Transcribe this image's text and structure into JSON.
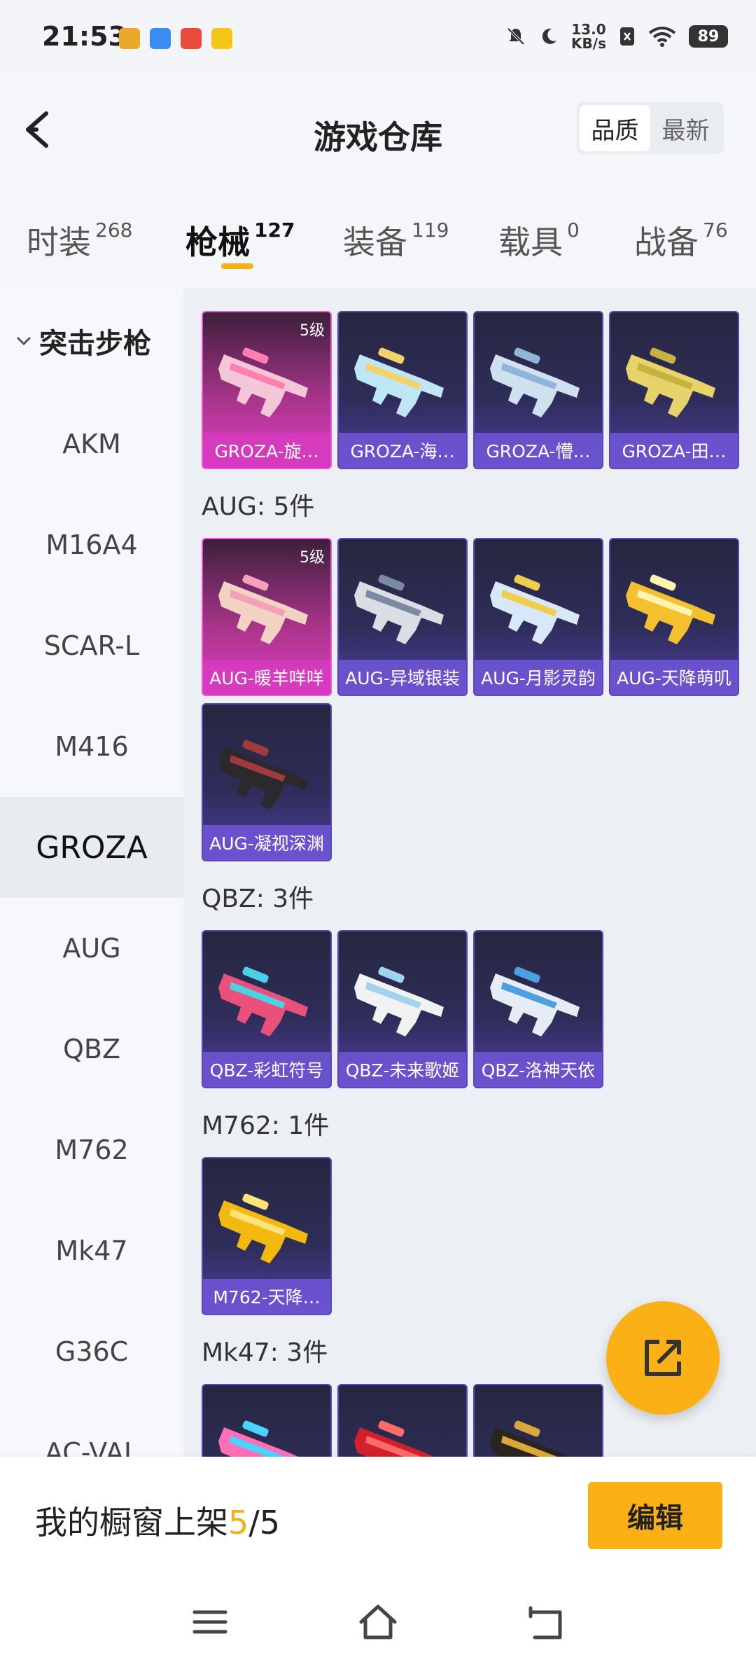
{
  "status_bar": {
    "time": "21:53",
    "net_speed_value": "13.0",
    "net_speed_unit": "KB/s",
    "battery": "89",
    "app_icons": [
      {
        "name": "app-icon-1",
        "color": "#e9a92a"
      },
      {
        "name": "app-icon-2",
        "color": "#3b8cf0"
      },
      {
        "name": "app-icon-3",
        "color": "#e84b3c"
      },
      {
        "name": "app-icon-4",
        "color": "#f5c518"
      }
    ]
  },
  "header": {
    "title": "游戏仓库",
    "sort_options": [
      "品质",
      "最新"
    ],
    "sort_active": "品质"
  },
  "tabs": [
    {
      "label": "时装",
      "count": "268"
    },
    {
      "label": "枪械",
      "count": "127",
      "active": true
    },
    {
      "label": "装备",
      "count": "119"
    },
    {
      "label": "载具",
      "count": "0"
    },
    {
      "label": "战备",
      "count": "76"
    }
  ],
  "sidebar": {
    "category": "突击步枪",
    "items": [
      "AKM",
      "M16A4",
      "SCAR-L",
      "M416",
      "GROZA",
      "AUG",
      "QBZ",
      "M762",
      "Mk47",
      "G36C",
      "AC-VAL"
    ],
    "active": "GROZA"
  },
  "groups": [
    {
      "title": "",
      "cards": [
        {
          "label": "GROZA-旋…",
          "level": "5级",
          "rarity": "legendary"
        },
        {
          "label": "GROZA-海…",
          "rarity": "epic"
        },
        {
          "label": "GROZA-懵…",
          "rarity": "epic"
        },
        {
          "label": "GROZA-田…",
          "rarity": "epic"
        }
      ]
    },
    {
      "title": "AUG: 5件",
      "cards": [
        {
          "label": "AUG-暖羊咩咩",
          "level": "5级",
          "rarity": "legendary"
        },
        {
          "label": "AUG-异域银装",
          "rarity": "epic"
        },
        {
          "label": "AUG-月影灵韵",
          "rarity": "epic"
        },
        {
          "label": "AUG-天降萌叽",
          "rarity": "epic"
        },
        {
          "label": "AUG-凝视深渊",
          "rarity": "epic"
        }
      ]
    },
    {
      "title": "QBZ: 3件",
      "cards": [
        {
          "label": "QBZ-彩虹符号",
          "rarity": "epic"
        },
        {
          "label": "QBZ-未来歌姬",
          "rarity": "epic"
        },
        {
          "label": "QBZ-洛神天依",
          "rarity": "epic"
        }
      ]
    },
    {
      "title": "M762: 1件",
      "cards": [
        {
          "label": "M762-天降…",
          "rarity": "epic"
        }
      ]
    },
    {
      "title": "Mk47: 3件",
      "cards": [
        {
          "label": "",
          "rarity": "epic"
        },
        {
          "label": "",
          "rarity": "epic"
        },
        {
          "label": "",
          "rarity": "epic"
        }
      ]
    }
  ],
  "gun_colors": [
    [
      "#f3c6d8",
      "#ff7fb0"
    ],
    [
      "#bfe6f5",
      "#f2d36b"
    ],
    [
      "#cfe0ef",
      "#8fb6d8"
    ],
    [
      "#e6d36a",
      "#c8b23e"
    ],
    [
      "#f2d2c2",
      "#f5a0b8"
    ],
    [
      "#d9dde4",
      "#7b8aa3"
    ],
    [
      "#d8e8f8",
      "#f0cd4a"
    ],
    [
      "#f4c02d",
      "#fff3b0"
    ],
    [
      "#2a2a2e",
      "#a13a3a"
    ],
    [
      "#e9507a",
      "#4cd0e6"
    ],
    [
      "#f2f2f2",
      "#9fd3f0"
    ],
    [
      "#e6ecf5",
      "#4aa0e0"
    ],
    [
      "#f2b90f",
      "#ffe27a"
    ],
    [
      "#ff6fb5",
      "#4ad3ff"
    ],
    [
      "#d4202a",
      "#ff6a6a"
    ],
    [
      "#2a2520",
      "#d8a83a"
    ]
  ],
  "bottom": {
    "showcase_prefix": "我的橱窗上架",
    "showcase_count": "5",
    "showcase_total": "/5",
    "edit_label": "编辑"
  },
  "theme": {
    "accent": "#f5b015",
    "legendary": "#e13fc6",
    "epic": "#5a48b8"
  }
}
